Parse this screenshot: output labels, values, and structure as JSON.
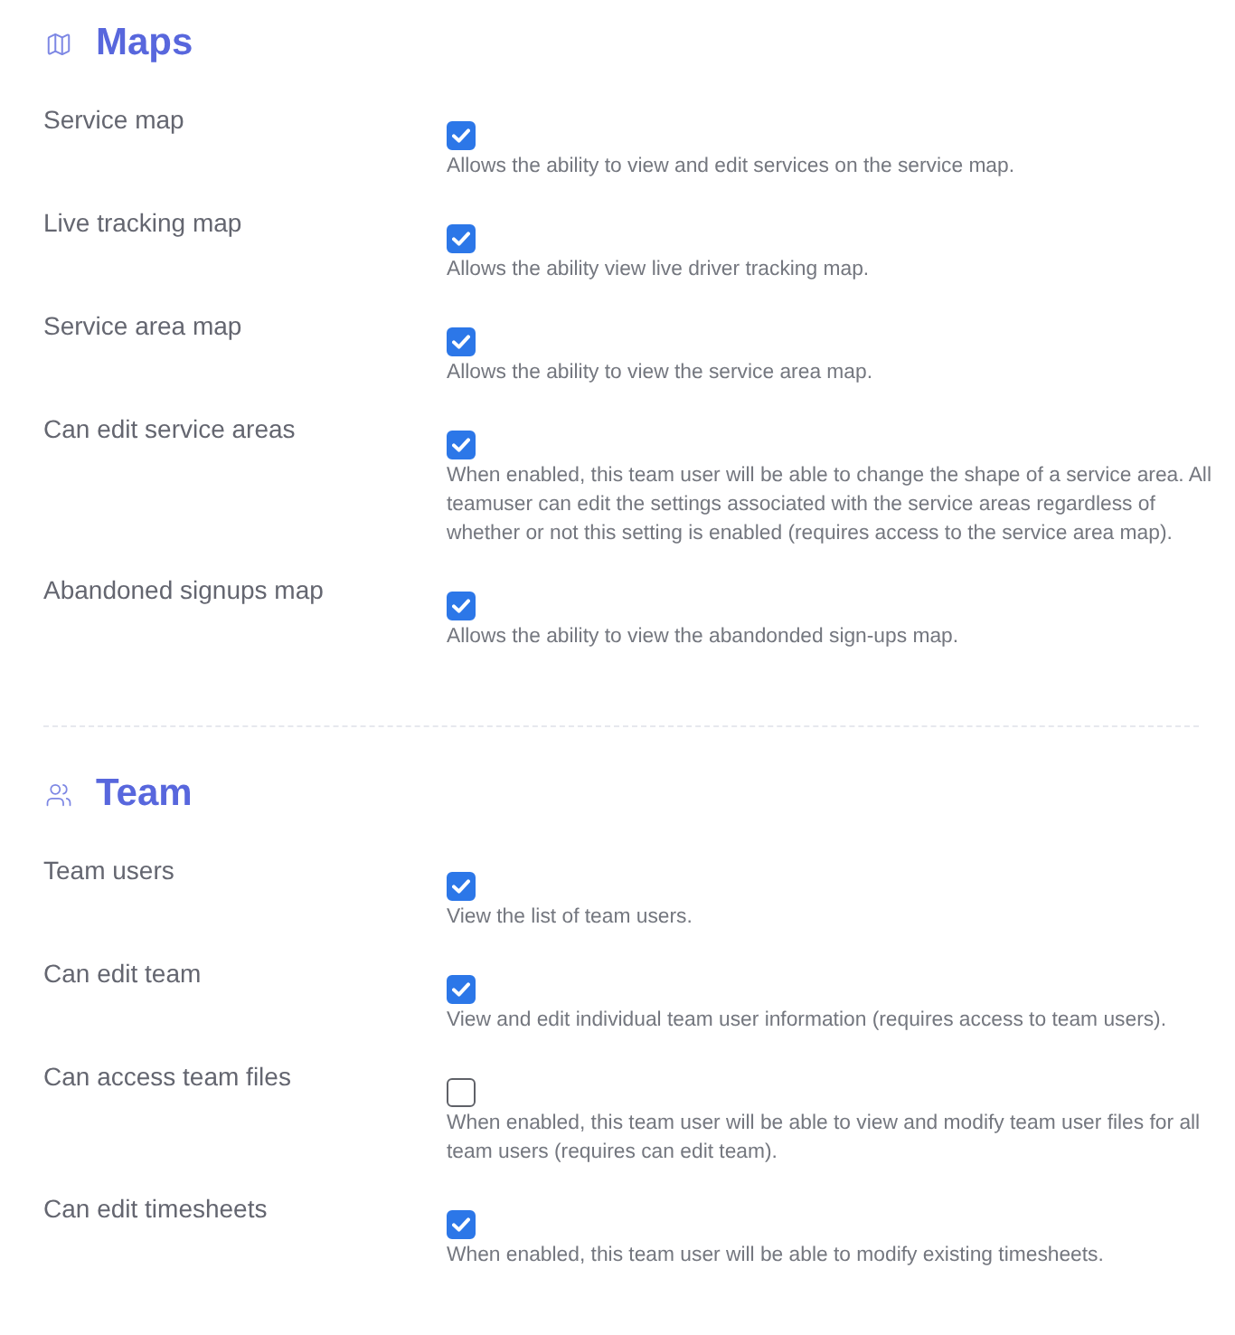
{
  "sections": [
    {
      "title": "Maps",
      "permissions": [
        {
          "label": "Service map",
          "checked": true,
          "description": "Allows the ability to view and edit services on the service map."
        },
        {
          "label": "Live tracking map",
          "checked": true,
          "description": "Allows the ability view live driver tracking map."
        },
        {
          "label": "Service area map",
          "checked": true,
          "description": "Allows the ability to view the service area map."
        },
        {
          "label": "Can edit service areas",
          "checked": true,
          "description": "When enabled, this team user will be able to change the shape of a service area. All teamuser can edit the settings associated with the service areas regardless of whether or not this setting is enabled (requires access to the service area map)."
        },
        {
          "label": "Abandoned signups map",
          "checked": true,
          "description": "Allows the ability to view the abandonded sign-ups map."
        }
      ]
    },
    {
      "title": "Team",
      "permissions": [
        {
          "label": "Team users",
          "checked": true,
          "description": "View the list of team users."
        },
        {
          "label": "Can edit team",
          "checked": true,
          "description": "View and edit individual team user information (requires access to team users)."
        },
        {
          "label": "Can access team files",
          "checked": false,
          "description": "When enabled, this team user will be able to view and modify team user files for all team users (requires can edit team)."
        },
        {
          "label": "Can edit timesheets",
          "checked": true,
          "description": "When enabled, this team user will be able to modify existing timesheets."
        }
      ]
    }
  ]
}
